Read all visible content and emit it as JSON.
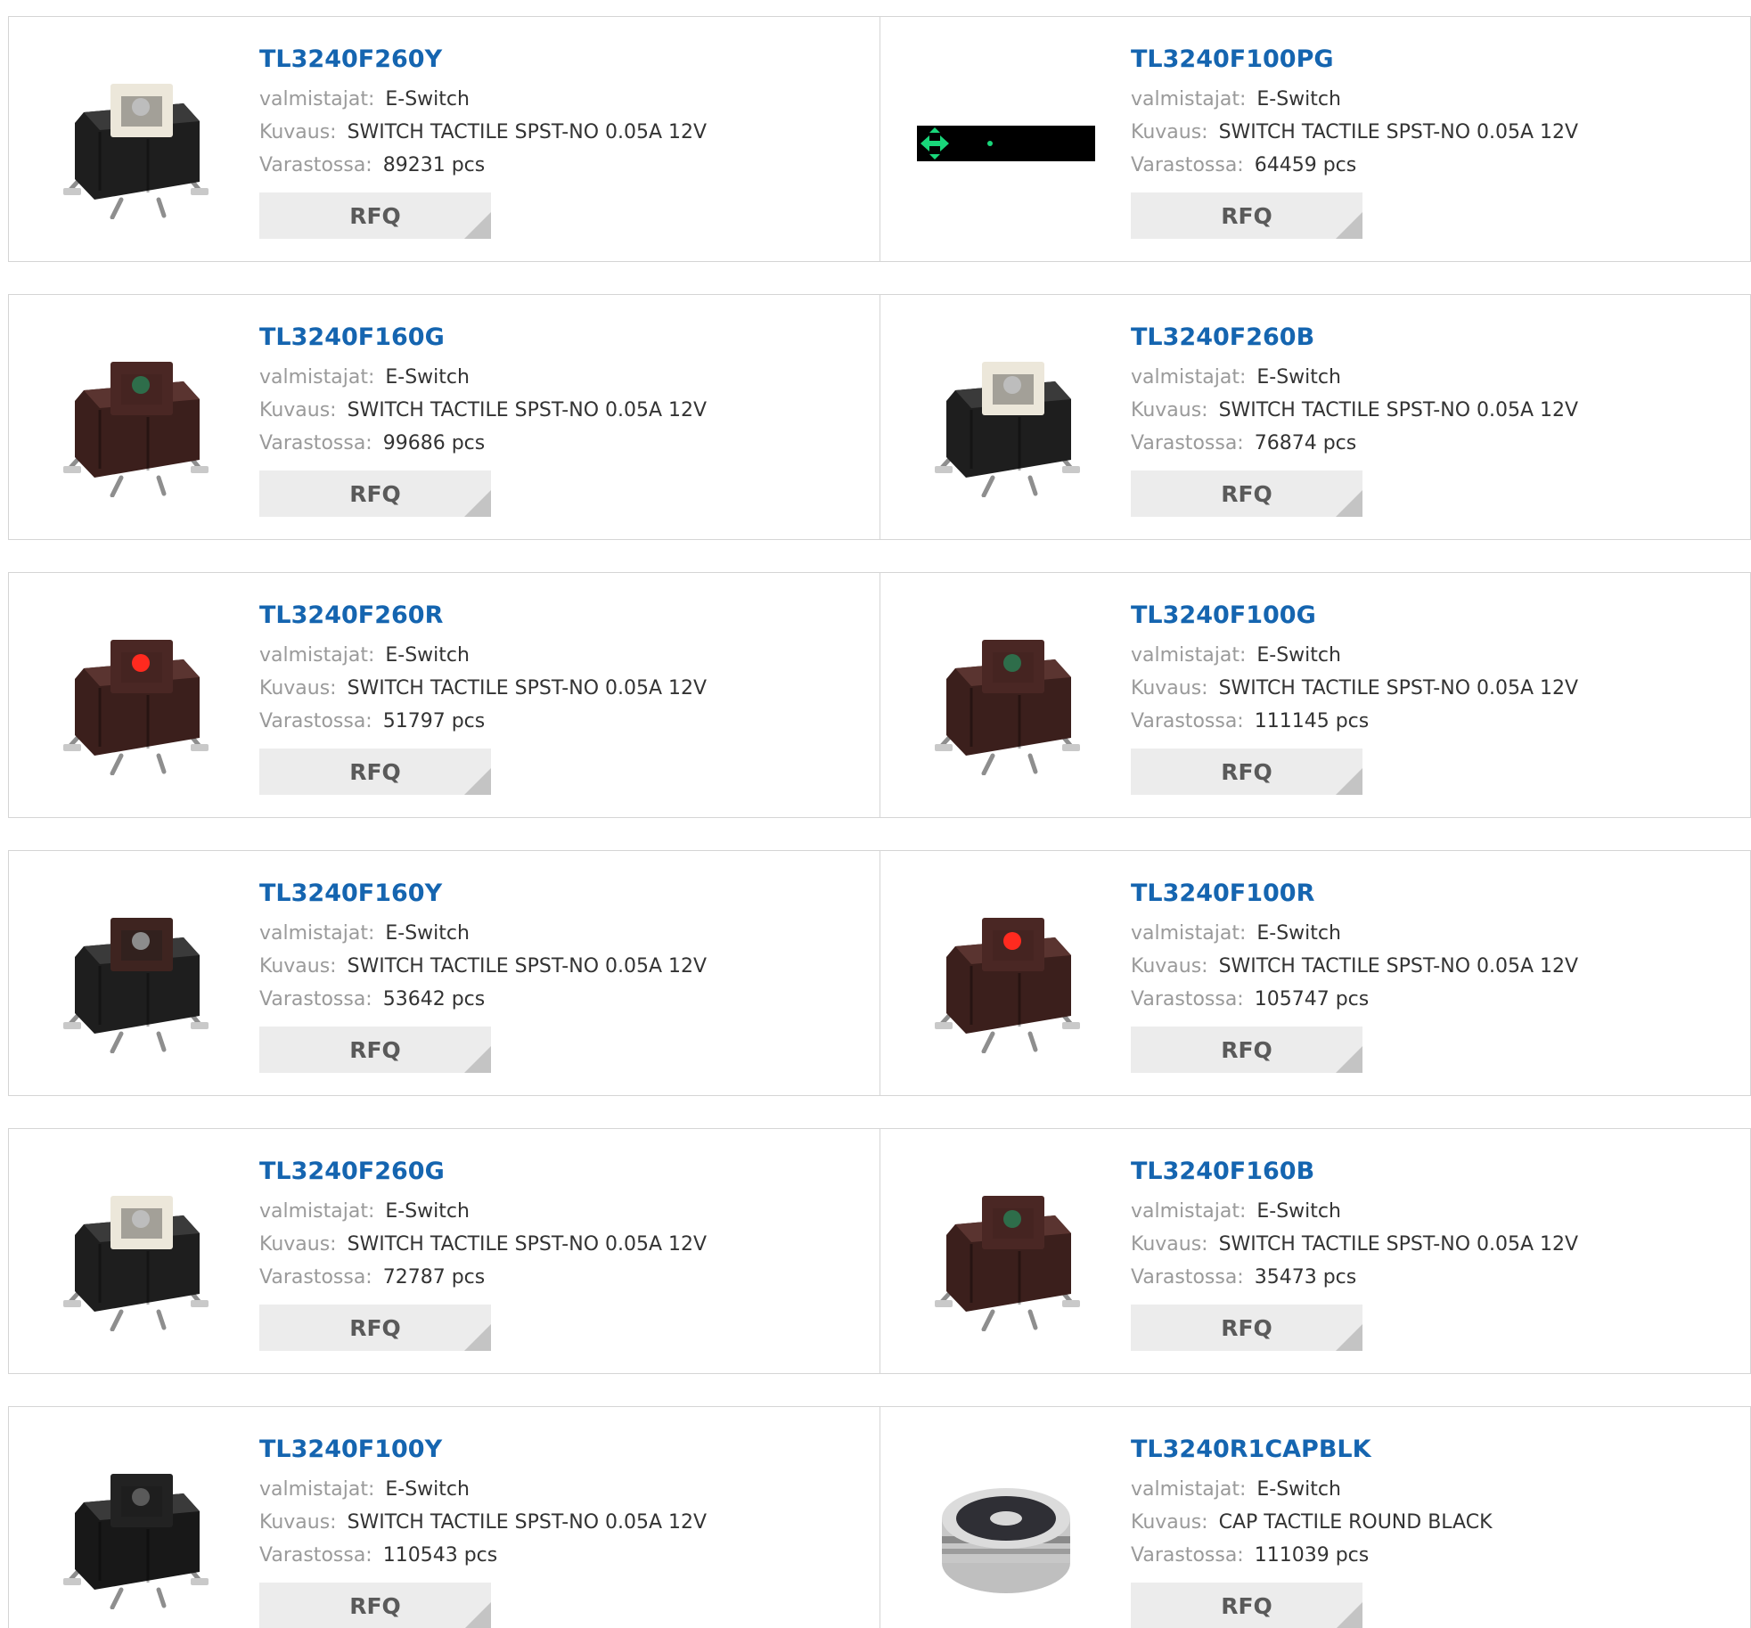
{
  "labels": {
    "manufacturer": "valmistajat:",
    "description": "Kuvaus:",
    "stock": "Varastossa:",
    "rfq": "RFQ"
  },
  "products": [
    {
      "part": "TL3240F260Y",
      "manufacturer": "E-Switch",
      "description": "SWITCH TACTILE SPST-NO 0.05A 12V",
      "stock": "89231 pcs",
      "image": "switch-black-white-cap"
    },
    {
      "part": "TL3240F100PG",
      "manufacturer": "E-Switch",
      "description": "SWITCH TACTILE SPST-NO 0.05A 12V",
      "stock": "64459 pcs",
      "image": "black-strip-green-arrows"
    },
    {
      "part": "TL3240F160G",
      "manufacturer": "E-Switch",
      "description": "SWITCH TACTILE SPST-NO 0.05A 12V",
      "stock": "99686 pcs",
      "image": "switch-brown"
    },
    {
      "part": "TL3240F260B",
      "manufacturer": "E-Switch",
      "description": "SWITCH TACTILE SPST-NO 0.05A 12V",
      "stock": "76874 pcs",
      "image": "switch-black-white-cap"
    },
    {
      "part": "TL3240F260R",
      "manufacturer": "E-Switch",
      "description": "SWITCH TACTILE SPST-NO 0.05A 12V",
      "stock": "51797 pcs",
      "image": "switch-brown-red-led"
    },
    {
      "part": "TL3240F100G",
      "manufacturer": "E-Switch",
      "description": "SWITCH TACTILE SPST-NO 0.05A 12V",
      "stock": "111145 pcs",
      "image": "switch-brown"
    },
    {
      "part": "TL3240F160Y",
      "manufacturer": "E-Switch",
      "description": "SWITCH TACTILE SPST-NO 0.05A 12V",
      "stock": "53642 pcs",
      "image": "switch-black-brown-cap"
    },
    {
      "part": "TL3240F100R",
      "manufacturer": "E-Switch",
      "description": "SWITCH TACTILE SPST-NO 0.05A 12V",
      "stock": "105747 pcs",
      "image": "switch-brown-red-led"
    },
    {
      "part": "TL3240F260G",
      "manufacturer": "E-Switch",
      "description": "SWITCH TACTILE SPST-NO 0.05A 12V",
      "stock": "72787 pcs",
      "image": "switch-black-white-cap"
    },
    {
      "part": "TL3240F160B",
      "manufacturer": "E-Switch",
      "description": "SWITCH TACTILE SPST-NO 0.05A 12V",
      "stock": "35473 pcs",
      "image": "switch-brown"
    },
    {
      "part": "TL3240F100Y",
      "manufacturer": "E-Switch",
      "description": "SWITCH TACTILE SPST-NO 0.05A 12V",
      "stock": "110543 pcs",
      "image": "switch-black"
    },
    {
      "part": "TL3240R1CAPBLK",
      "manufacturer": "E-Switch",
      "description": "CAP TACTILE ROUND BLACK",
      "stock": "111039 pcs",
      "image": "round-cap-black"
    }
  ],
  "colors": {
    "link": "#1565b0",
    "label": "#9a9a9a",
    "value": "#333333",
    "border": "#d5d5d5",
    "button_bg": "#ececec",
    "button_text": "#5a5a5a"
  }
}
